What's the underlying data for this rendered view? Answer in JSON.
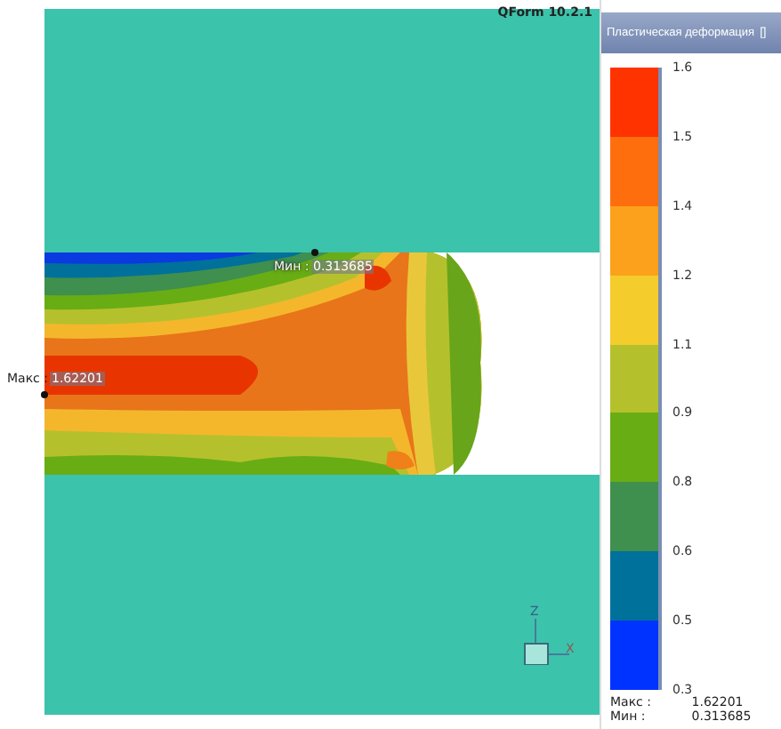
{
  "app": {
    "version": "QForm 10.2.1"
  },
  "viewport": {
    "max_marker": {
      "label": "Макс :",
      "value": "1.62201"
    },
    "min_marker": {
      "label": "Мин :",
      "value": "0.313685"
    },
    "axes": {
      "z_label": "Z",
      "x_label": "X"
    }
  },
  "legend": {
    "title": "Пластическая деформация",
    "unit": "[]",
    "bands": [
      {
        "color": "#ff3300"
      },
      {
        "color": "#ff6e0c"
      },
      {
        "color": "#fca11c"
      },
      {
        "color": "#f4cc2c"
      },
      {
        "color": "#b5c12c"
      },
      {
        "color": "#68ad14"
      },
      {
        "color": "#3f8f4f"
      },
      {
        "color": "#00719a"
      },
      {
        "color": "#0033ff"
      }
    ],
    "ticks": [
      "1.6",
      "1.5",
      "1.4",
      "1.2",
      "1.1",
      "0.9",
      "0.8",
      "0.6",
      "0.5",
      "0.3"
    ],
    "max_label": "Макс :",
    "max_value": "1.62201",
    "min_label": "Мин :",
    "min_value": "0.313685"
  }
}
